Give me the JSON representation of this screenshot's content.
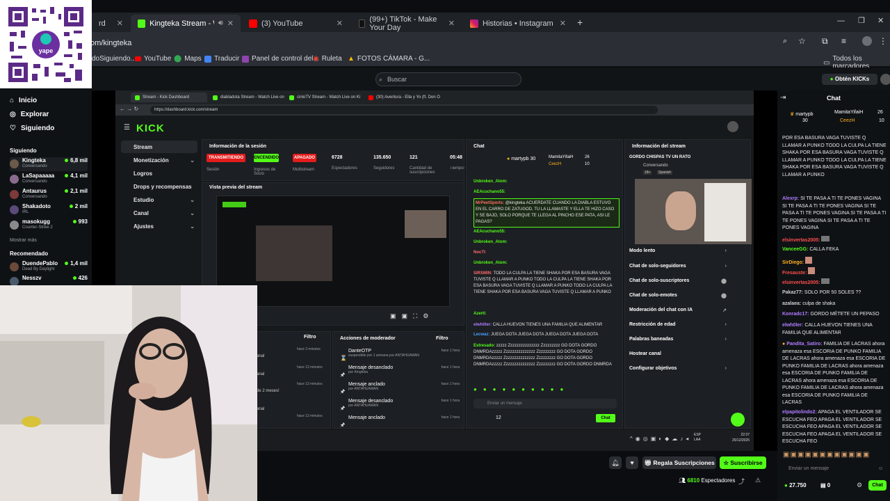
{
  "browser": {
    "tabs": [
      {
        "label": "rd",
        "partial": true
      },
      {
        "label": "Kingteka Stream - Watch Li",
        "active": true
      },
      {
        "label": "(3) YouTube"
      },
      {
        "label": "(99+) TikTok - Make Your Day"
      },
      {
        "label": "Historias • Instagram"
      }
    ],
    "url": "om/kingteka",
    "bookmarks": [
      "doSiguiendo...",
      "YouTube",
      "Maps",
      "Traducir",
      "Panel de control del...",
      "Ruleta",
      "FOTOS CÁMARA - G...",
      "Todos los marcadores"
    ]
  },
  "qr": {
    "brand": "yape"
  },
  "kick": {
    "search_placeholder": "Buscar",
    "get_kicks": "Obtén KICKs",
    "nav": [
      "Inicio",
      "Explorar",
      "Siguiendo"
    ],
    "following_title": "Siguiendo",
    "following": [
      {
        "name": "Kingteka",
        "sub": "Conversando",
        "viewers": "6,8 mil"
      },
      {
        "name": "LaSapaaaaa",
        "sub": "Conversando",
        "viewers": "4,1 mil"
      },
      {
        "name": "Antaurus",
        "sub": "Conversando",
        "viewers": "2,1 mil"
      },
      {
        "name": "Shakadoto",
        "sub": "IRL",
        "viewers": "2 mil"
      },
      {
        "name": "masokugg",
        "sub": "Counter-Strike 2",
        "viewers": "993"
      }
    ],
    "show_more": "Mostrar más",
    "recommended_title": "Recomendado",
    "recommended": [
      {
        "name": "DuendePablo",
        "sub": "Dead By Daylight",
        "viewers": "1,4 mil"
      },
      {
        "name": "Nesszv",
        "sub": "",
        "viewers": "426"
      }
    ]
  },
  "inner_browser": {
    "tabs": [
      "Stream - Kick Dashboard",
      "diabladota Stream - Watch Live on",
      "cinloTV Stream - Watch Live on Ki",
      "(30) Aventura - Ella y Yo (ft. Don O"
    ],
    "url": "https://dashboard.kick.com/stream",
    "logo": "KICK",
    "nav": [
      {
        "label": "Stream",
        "selected": true
      },
      {
        "label": "Monetización",
        "chev": true
      },
      {
        "label": "Logros"
      },
      {
        "label": "Drops y recompensas"
      },
      {
        "label": "Estudio",
        "chev": true
      },
      {
        "label": "Canal",
        "chev": true
      },
      {
        "label": "Ajustes",
        "chev": true
      }
    ],
    "session": {
      "title": "Información de la sesión",
      "buttons": [
        "TRANSMITIENDO",
        "ENCENDIDO",
        "APAGADO"
      ],
      "stats": [
        {
          "value": "6728",
          "label": "Espectadores"
        },
        {
          "value": "135.650",
          "label": "Seguidores"
        },
        {
          "value": "121",
          "label": "Cantidad de suscripciones"
        },
        {
          "value": "05:48",
          "label": "Tiempo en vivo"
        }
      ],
      "labels": [
        "Sesión",
        "Ingresos de Socio",
        "Multistream"
      ]
    },
    "preview_title": "Vista previa del stream",
    "chat": {
      "title": "Chat",
      "pinned": {
        "user": "martypb",
        "rank1": "MamitaYifaiH",
        "rank2": "CeezH",
        "n1": "30",
        "n2": "26",
        "n3": "10"
      },
      "messages": [
        {
          "user": "Unbroken_Atom:",
          "text": ""
        },
        {
          "user": "AEAcuchano55:",
          "text": ""
        },
        {
          "user": "MrPeetSports:",
          "text": "@kingteka ACUERDATE CUANDO LA DIABLA ESTUVO EN EL CARRO DE ZATUGOD, TU LA LLAMASTE Y ELLA TE HIZO CASO Y SE BAJO, SOLO PORQUE TE LLEGA AL PINCHO ESE PATA, ASI LE PAGAS?",
          "hl": true
        },
        {
          "user": "AEAcuchano55:",
          "text": ""
        },
        {
          "user": "Unbroken_Atom:",
          "text": ""
        },
        {
          "user": "Noc7l:",
          "text": ""
        },
        {
          "user": "Unbroken_Atom:",
          "text": ""
        },
        {
          "user": "SIRSMIN:",
          "text": "TODO LA CULPA LA TIENE SHAKA POR ESA BASURA VAGA TUVISTE Q LLAMAR A PUNKO TODO LA CULPA LA TIENE SHAKA POR ESA BASURA VAGA TUVISTE Q LLAMAR A PUNKO TODO LA CULPA LA TIENE SHAKA POR ESA BASURA VAGA TUVISTE Q LLAMAR A PUNKO"
        },
        {
          "user": "Azerti:",
          "text": ""
        },
        {
          "user": "elwh0ler:",
          "text": "CALLA HUEVON TIENES UNA FAMILIA QUE ALIMENTAR"
        },
        {
          "user": "Lecwaz:",
          "text": "JUEGA DOTA JUEGA DOTA JUEGA DOTA JUEGA DOTA"
        },
        {
          "user": "Estresado:",
          "text": "zzzzz Zzzzzzzzzzzzzzz Zzzzzzzzz GO DOTA GORDO DNMRDAzzzzz Zzzzzzzzzzzzzzz Zzzzzzzzz GO DOTA GORDO DNMRDAzzzzz Zzzzzzzzzzzzzzz Zzzzzzzzz GO DOTA GORDO DNMRDAzzzzz Zzzzzzzzzzzzzzz Zzzzzzzzz GO DOTA GORDO DNMRDA"
        }
      ],
      "input_placeholder": "Enviar un mensaje",
      "count": "12",
      "send": "Chat"
    },
    "mod_actions": {
      "title": "Acciones de moderador",
      "filter": "Filtro",
      "items": [
        {
          "title": "DanteOTP",
          "sub": "suspendido por 1 semana por ANTAHUAMAN",
          "time": "hace 1 hora"
        },
        {
          "title": "Mensaje desanclado",
          "sub": "por Kingteka",
          "time": "hace 1 hora"
        },
        {
          "title": "Mensaje anclado",
          "sub": "por ANTAHUAMAN",
          "time": "hace 1 hora"
        },
        {
          "title": "Mensaje desanclado",
          "sub": "por ANTAHUAMAN",
          "time": "hace 1 hora"
        },
        {
          "title": "Mensaje anclado",
          "sub": "",
          "time": "hace 1 hora"
        }
      ]
    },
    "left_activity": {
      "filter": "Filtro",
      "times": [
        "hace 3 minutos",
        "hace 13 minutos",
        "hace 13 minutos",
        "hace 13 minutos"
      ],
      "partial": [
        "anal",
        "anal",
        "de 2 meses!",
        "anal"
      ]
    },
    "stream_info": {
      "title": "Información del stream",
      "stream_title": "GORDO CHISPAS TV UN RATO",
      "category": "Conversando",
      "tags": [
        "18+",
        "Spanish"
      ],
      "settings": [
        "Modo lento",
        "Chat de solo-seguidores",
        "Chat de solo-suscriptores",
        "Chat de solo-emotes",
        "Moderación del chat con IA",
        "Restricción de edad",
        "Palabras baneadas",
        "Hostear canal",
        "Configurar objetivos"
      ]
    },
    "tray": {
      "lang": "ESP LAA",
      "time": "22:37",
      "date": "25/12/2025"
    }
  },
  "below_stream": {
    "gift_subs": "Regala Suscripciones",
    "subscribe": "Suscribirse",
    "viewers": "6810",
    "viewers_label": "Espectadores"
  },
  "right_chat": {
    "title": "Chat",
    "pinned": {
      "user": "martypb",
      "rank1": "MamitaYifaiH",
      "rank2": "CeezH",
      "n1": "30",
      "n2": "26",
      "n3": "10"
    },
    "messages": [
      {
        "user": "",
        "text": "POR ESA BASURA VAGA TUVISTE Q LLAMAR A PUNKO TODO LA CULPA LA TIENE SHAKA POR ESA BASURA VAGA TUVISTE Q LLAMAR A PUNKO TODO LA CULPA LA TIENE SHAKA POR ESA BASURA VAGA TUVISTE Q LLAMAR A PUNKO",
        "color": "#ffffff"
      },
      {
        "user": "Alexrp:",
        "text": "SI TE PASA A TI TE PONES VAGINA SI TE PASA A TI TE PONES VAGINA SI TE PASA A TI TE PONES VAGINA SI TE PASA A TI TE PONES VAGINA SI TE PASA A TI TE PONES VAGINA",
        "color": "#b07cff"
      },
      {
        "user": "elsinvertas2005:",
        "text": "",
        "color": "#ff4d4d"
      },
      {
        "user": "VanceeGG:",
        "text": "CALLA FEKA",
        "color": "#53fc18"
      },
      {
        "user": "SirDiego:",
        "text": "",
        "color": "#ffb020"
      },
      {
        "user": "Fresauste:",
        "text": "",
        "color": "#ff4d4d"
      },
      {
        "user": "elsinvertas2005:",
        "text": "",
        "color": "#ff4d4d"
      },
      {
        "user": "Pakaz77:",
        "text": "SOLO POR 50 SOLES ??",
        "color": "#cfcfcf"
      },
      {
        "user": "azalaea:",
        "text": "culpa de shaka",
        "color": "#cfcfcf"
      },
      {
        "user": "Konradc17:",
        "text": "GORDO MÉTETE UN PEPASO",
        "color": "#b07cff"
      },
      {
        "user": "elwh0ler:",
        "text": "CALLA HUEVON TIENES UNA FAMILIA QUE ALIMENTAR",
        "color": "#b07cff"
      },
      {
        "user": "Pandita_Satiro:",
        "text": "FAMILIA DE LACRAS ahora amenaza esa ESCORIA DE PUNKO FAMILIA DE LACRAS ahora amenaza esa ESCORIA DE PUNKO FAMILIA DE LACRAS ahora amenaza esa ESCORIA DE PUNKO FAMILIA DE LACRAS ahora amenaza esa ESCORIA DE PUNKO FAMILIA DE LACRAS ahora amenaza esa ESCORIA DE PUNKO FAMILIA DE LACRAS",
        "color": "#b07cff"
      },
      {
        "user": "elpapitolindo2:",
        "text": "APAGA EL VENTILADOR SE ESCUCHA FEO APAGA EL VENTILADOR SE ESCUCHA FEO APAGA EL VENTILADOR SE ESCUCHA FEO APAGA EL VENTILADOR SE ESCUCHA FEO",
        "color": "#b07cff"
      }
    ],
    "input_placeholder": "Enviar un mensaje",
    "kicks": "27.750",
    "count": "0",
    "send": "Chat"
  },
  "colors": {
    "accent": "#53fc18",
    "live": "#e31c1c"
  }
}
